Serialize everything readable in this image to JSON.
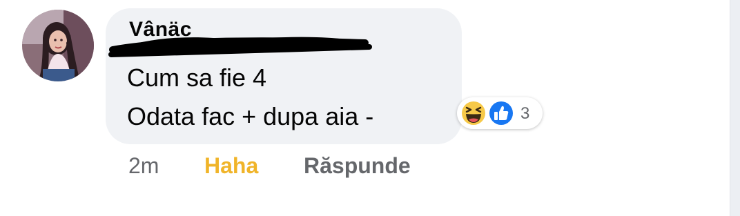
{
  "comment": {
    "author": "Vânäc",
    "lines": [
      "Cum sa fie 4",
      "Odata fac + dupa aia -"
    ],
    "time": "2m",
    "reaction_count": "3",
    "reaction_icons": [
      "haha-icon",
      "like-icon"
    ],
    "actions": {
      "react_label": "Haha",
      "reply_label": "Răspunde"
    }
  },
  "colors": {
    "bubble": "#f0f2f5",
    "text": "#050505",
    "secondary": "#65676b",
    "haha": "#f0b429",
    "like": "#1877f2"
  }
}
